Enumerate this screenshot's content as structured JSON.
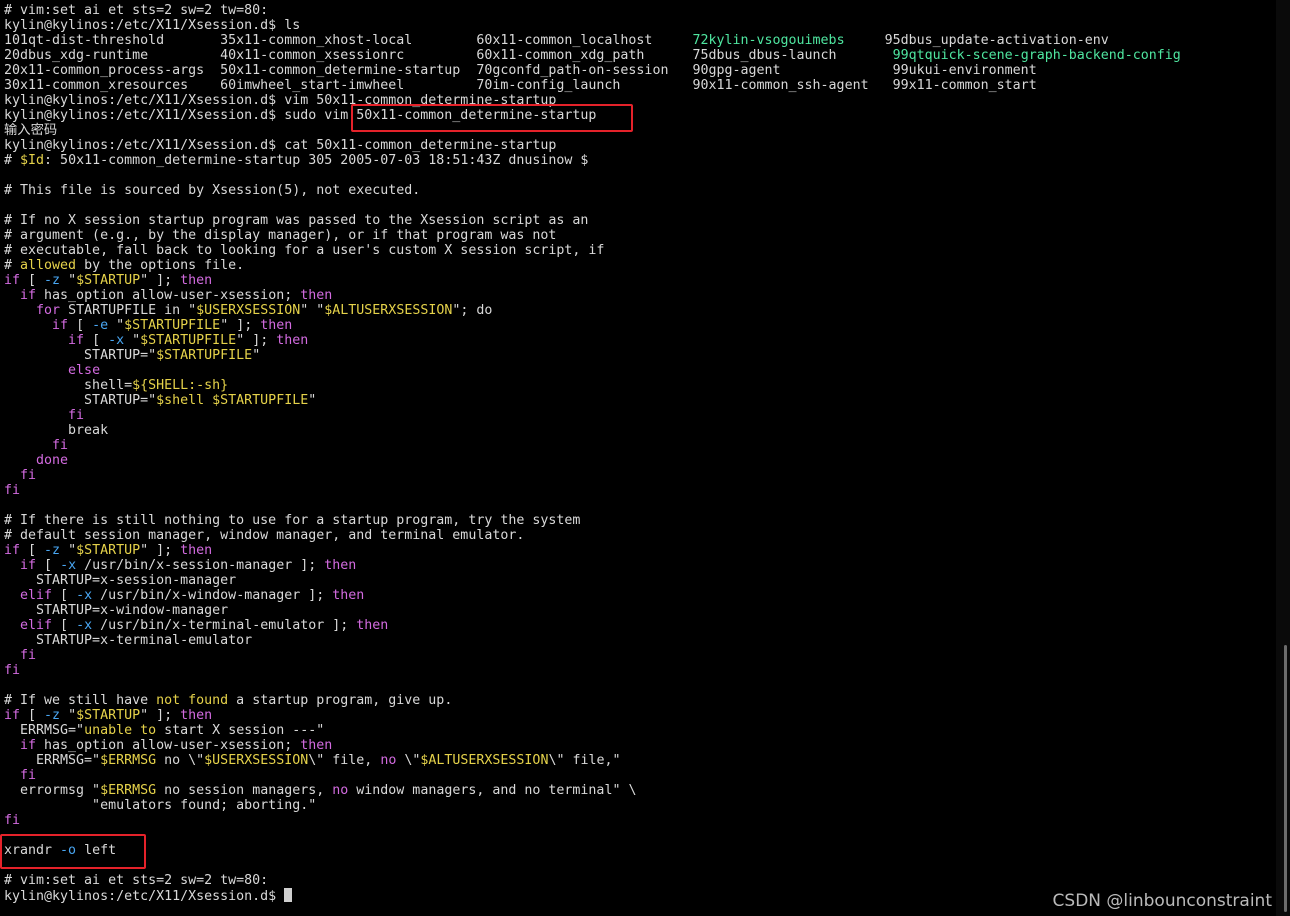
{
  "terminal": {
    "lines": [
      [
        {
          "t": "# vim:set ai et sts=2 sw=2 tw=80:",
          "c": "text"
        }
      ],
      [
        {
          "t": "kylin@kylinos:/etc/X11/Xsession.d$ ls",
          "c": "text"
        }
      ],
      [
        {
          "t": "101qt-dist-threshold       35x11-common_xhost-local        60x11-common_localhost     ",
          "c": "text"
        },
        {
          "t": "72kylin-vsogouimebs",
          "c": "green"
        },
        {
          "t": "     95dbus_update-activation-env",
          "c": "text"
        }
      ],
      [
        {
          "t": "20dbus_xdg-runtime         40x11-common_xsessionrc         60x11-common_xdg_path      75dbus_dbus-launch       ",
          "c": "text"
        },
        {
          "t": "99qtquick-scene-graph-backend-config",
          "c": "green"
        }
      ],
      [
        {
          "t": "20x11-common_process-args  50x11-common_determine-startup  70gconfd_path-on-session   90gpg-agent              99ukui-environment",
          "c": "text"
        }
      ],
      [
        {
          "t": "30x11-common_xresources    60imwheel_start-imwheel         70im-config_launch         90x11-common_ssh-agent   99x11-common_start",
          "c": "text"
        }
      ],
      [
        {
          "t": "kylin@kylinos:/etc/X11/Xsession.d$ vim 50x11-common_determine-startup",
          "c": "text"
        }
      ],
      [
        {
          "t": "kylin@kylinos:/etc/X11/Xsession.d$ sudo vim 50x11-common_determine-startup",
          "c": "text"
        }
      ],
      [
        {
          "t": "输入密码",
          "c": "text"
        }
      ],
      [
        {
          "t": "kylin@kylinos:/etc/X11/Xsession.d$ cat 50x11-common_determine-startup",
          "c": "text"
        }
      ],
      [
        {
          "t": "# ",
          "c": "text"
        },
        {
          "t": "$Id",
          "c": "var"
        },
        {
          "t": ": 50x11-common_determine-startup 305 2005-07-03 18:51:43Z dnusinow $",
          "c": "text"
        }
      ],
      [
        {
          "t": "",
          "c": "text"
        }
      ],
      [
        {
          "t": "# This file is sourced by Xsession(5), not executed.",
          "c": "text"
        }
      ],
      [
        {
          "t": "",
          "c": "text"
        }
      ],
      [
        {
          "t": "# If no X session startup program was passed to the Xsession script as an",
          "c": "text"
        }
      ],
      [
        {
          "t": "# argument (e.g., by the display manager), or if that program was not",
          "c": "text"
        }
      ],
      [
        {
          "t": "# executable, fall back to looking for a user's custom X session script, if",
          "c": "text"
        }
      ],
      [
        {
          "t": "# ",
          "c": "text"
        },
        {
          "t": "allowed",
          "c": "str"
        },
        {
          "t": " by the options file.",
          "c": "text"
        }
      ],
      [
        {
          "t": "if",
          "c": "kw"
        },
        {
          "t": " [ ",
          "c": "text"
        },
        {
          "t": "-z",
          "c": "op"
        },
        {
          "t": " \"",
          "c": "text"
        },
        {
          "t": "$STARTUP",
          "c": "var"
        },
        {
          "t": "\" ]; ",
          "c": "text"
        },
        {
          "t": "then",
          "c": "kw"
        }
      ],
      [
        {
          "t": "  ",
          "c": "text"
        },
        {
          "t": "if",
          "c": "kw"
        },
        {
          "t": " has_option allow-user-xsession; ",
          "c": "text"
        },
        {
          "t": "then",
          "c": "kw"
        }
      ],
      [
        {
          "t": "    ",
          "c": "text"
        },
        {
          "t": "for",
          "c": "kw"
        },
        {
          "t": " STARTUPFILE in \"",
          "c": "text"
        },
        {
          "t": "$USERXSESSION",
          "c": "var"
        },
        {
          "t": "\" \"",
          "c": "text"
        },
        {
          "t": "$ALTUSERXSESSION",
          "c": "var"
        },
        {
          "t": "\"; do",
          "c": "text"
        }
      ],
      [
        {
          "t": "      ",
          "c": "text"
        },
        {
          "t": "if",
          "c": "kw"
        },
        {
          "t": " [ ",
          "c": "text"
        },
        {
          "t": "-e",
          "c": "op"
        },
        {
          "t": " \"",
          "c": "text"
        },
        {
          "t": "$STARTUPFILE",
          "c": "var"
        },
        {
          "t": "\" ]; ",
          "c": "text"
        },
        {
          "t": "then",
          "c": "kw"
        }
      ],
      [
        {
          "t": "        ",
          "c": "text"
        },
        {
          "t": "if",
          "c": "kw"
        },
        {
          "t": " [ ",
          "c": "text"
        },
        {
          "t": "-x",
          "c": "op"
        },
        {
          "t": " \"",
          "c": "text"
        },
        {
          "t": "$STARTUPFILE",
          "c": "var"
        },
        {
          "t": "\" ]; ",
          "c": "text"
        },
        {
          "t": "then",
          "c": "kw"
        }
      ],
      [
        {
          "t": "          STARTUP=\"",
          "c": "text"
        },
        {
          "t": "$STARTUPFILE",
          "c": "var"
        },
        {
          "t": "\"",
          "c": "text"
        }
      ],
      [
        {
          "t": "        ",
          "c": "text"
        },
        {
          "t": "else",
          "c": "kw"
        }
      ],
      [
        {
          "t": "          shell=",
          "c": "text"
        },
        {
          "t": "${SHELL:-sh}",
          "c": "var"
        }
      ],
      [
        {
          "t": "          STARTUP=\"",
          "c": "text"
        },
        {
          "t": "$shell $STARTUPFILE",
          "c": "var"
        },
        {
          "t": "\"",
          "c": "text"
        }
      ],
      [
        {
          "t": "        ",
          "c": "text"
        },
        {
          "t": "fi",
          "c": "kw"
        }
      ],
      [
        {
          "t": "        break",
          "c": "text"
        }
      ],
      [
        {
          "t": "      ",
          "c": "text"
        },
        {
          "t": "fi",
          "c": "kw"
        }
      ],
      [
        {
          "t": "    ",
          "c": "text"
        },
        {
          "t": "done",
          "c": "kw"
        }
      ],
      [
        {
          "t": "  ",
          "c": "text"
        },
        {
          "t": "fi",
          "c": "kw"
        }
      ],
      [
        {
          "t": "fi",
          "c": "kw"
        }
      ],
      [
        {
          "t": "",
          "c": "text"
        }
      ],
      [
        {
          "t": "# If there is still nothing to use for a startup program, try the system",
          "c": "text"
        }
      ],
      [
        {
          "t": "# default session manager, window manager, and terminal emulator.",
          "c": "text"
        }
      ],
      [
        {
          "t": "if",
          "c": "kw"
        },
        {
          "t": " [ ",
          "c": "text"
        },
        {
          "t": "-z",
          "c": "op"
        },
        {
          "t": " \"",
          "c": "text"
        },
        {
          "t": "$STARTUP",
          "c": "var"
        },
        {
          "t": "\" ]; ",
          "c": "text"
        },
        {
          "t": "then",
          "c": "kw"
        }
      ],
      [
        {
          "t": "  ",
          "c": "text"
        },
        {
          "t": "if",
          "c": "kw"
        },
        {
          "t": " [ ",
          "c": "text"
        },
        {
          "t": "-x",
          "c": "op"
        },
        {
          "t": " /usr/bin/x-session-manager ]; ",
          "c": "text"
        },
        {
          "t": "then",
          "c": "kw"
        }
      ],
      [
        {
          "t": "    STARTUP=x-session-manager",
          "c": "text"
        }
      ],
      [
        {
          "t": "  ",
          "c": "text"
        },
        {
          "t": "elif",
          "c": "kw"
        },
        {
          "t": " [ ",
          "c": "text"
        },
        {
          "t": "-x",
          "c": "op"
        },
        {
          "t": " /usr/bin/x-window-manager ]; ",
          "c": "text"
        },
        {
          "t": "then",
          "c": "kw"
        }
      ],
      [
        {
          "t": "    STARTUP=x-window-manager",
          "c": "text"
        }
      ],
      [
        {
          "t": "  ",
          "c": "text"
        },
        {
          "t": "elif",
          "c": "kw"
        },
        {
          "t": " [ ",
          "c": "text"
        },
        {
          "t": "-x",
          "c": "op"
        },
        {
          "t": " /usr/bin/x-terminal-emulator ]; ",
          "c": "text"
        },
        {
          "t": "then",
          "c": "kw"
        }
      ],
      [
        {
          "t": "    STARTUP=x-terminal-emulator",
          "c": "text"
        }
      ],
      [
        {
          "t": "  ",
          "c": "text"
        },
        {
          "t": "fi",
          "c": "kw"
        }
      ],
      [
        {
          "t": "fi",
          "c": "kw"
        }
      ],
      [
        {
          "t": "",
          "c": "text"
        }
      ],
      [
        {
          "t": "# If we still have ",
          "c": "text"
        },
        {
          "t": "not found",
          "c": "str"
        },
        {
          "t": " a startup program, give up.",
          "c": "text"
        }
      ],
      [
        {
          "t": "if",
          "c": "kw"
        },
        {
          "t": " [ ",
          "c": "text"
        },
        {
          "t": "-z",
          "c": "op"
        },
        {
          "t": " \"",
          "c": "text"
        },
        {
          "t": "$STARTUP",
          "c": "var"
        },
        {
          "t": "\" ]; ",
          "c": "text"
        },
        {
          "t": "then",
          "c": "kw"
        }
      ],
      [
        {
          "t": "  ERRMSG=\"",
          "c": "text"
        },
        {
          "t": "unable",
          "c": "str"
        },
        {
          "t": " ",
          "c": "text"
        },
        {
          "t": "to",
          "c": "str"
        },
        {
          "t": " start X session ---\"",
          "c": "text"
        }
      ],
      [
        {
          "t": "  ",
          "c": "text"
        },
        {
          "t": "if",
          "c": "kw"
        },
        {
          "t": " has_option allow-user-xsession; ",
          "c": "text"
        },
        {
          "t": "then",
          "c": "kw"
        }
      ],
      [
        {
          "t": "    ERRMSG=\"",
          "c": "text"
        },
        {
          "t": "$ERRMSG",
          "c": "var"
        },
        {
          "t": " no \\\"",
          "c": "text"
        },
        {
          "t": "$USERXSESSION",
          "c": "var"
        },
        {
          "t": "\\\" file, ",
          "c": "text"
        },
        {
          "t": "no",
          "c": "kw"
        },
        {
          "t": " \\\"",
          "c": "text"
        },
        {
          "t": "$ALTUSERXSESSION",
          "c": "var"
        },
        {
          "t": "\\\" file,\"",
          "c": "text"
        }
      ],
      [
        {
          "t": "  ",
          "c": "text"
        },
        {
          "t": "fi",
          "c": "kw"
        }
      ],
      [
        {
          "t": "  errormsg \"",
          "c": "text"
        },
        {
          "t": "$ERRMSG",
          "c": "var"
        },
        {
          "t": " no session managers, ",
          "c": "text"
        },
        {
          "t": "no",
          "c": "kw"
        },
        {
          "t": " window managers, and no terminal\" \\",
          "c": "text"
        }
      ],
      [
        {
          "t": "           \"emulators found; aborting.\"",
          "c": "text"
        }
      ],
      [
        {
          "t": "fi",
          "c": "kw"
        }
      ],
      [
        {
          "t": "",
          "c": "text"
        }
      ],
      [
        {
          "t": "xrandr ",
          "c": "text"
        },
        {
          "t": "-o",
          "c": "op"
        },
        {
          "t": " left",
          "c": "text"
        }
      ],
      [
        {
          "t": "",
          "c": "text"
        }
      ],
      [
        {
          "t": "# vim:set ai et sts=2 sw=2 tw=80:",
          "c": "text"
        }
      ],
      [
        {
          "t": "kylin@kylinos:/etc/X11/Xsession.d$ ",
          "c": "text"
        },
        {
          "t": "",
          "c": "cursor"
        }
      ]
    ]
  },
  "watermark": {
    "text": "CSDN @linbounconstraint"
  },
  "colors": {
    "background": "#000000",
    "text": "#d9d9d9",
    "highlight_box": "#e5222a",
    "keyword": "#d36be0",
    "string": "#e5d24a",
    "option": "#49a6f2",
    "executable": "#4fe6a0"
  }
}
